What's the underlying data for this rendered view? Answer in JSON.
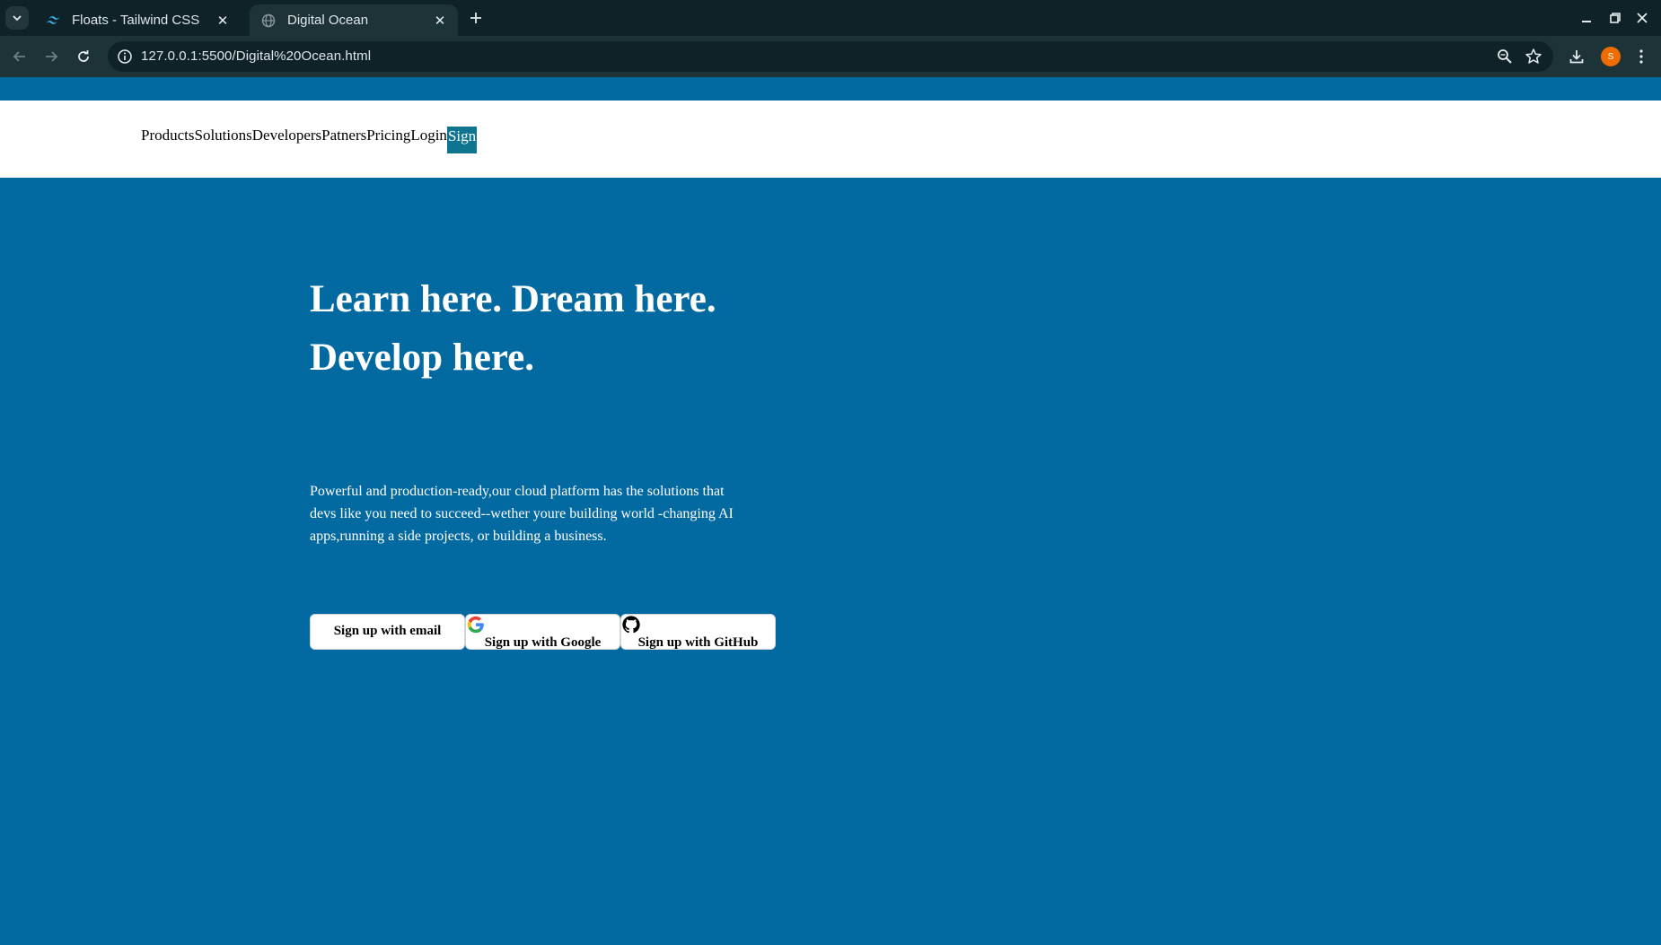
{
  "browser": {
    "tabs": [
      {
        "title": "Floats - Tailwind CSS",
        "favicon": "tailwind-icon"
      },
      {
        "title": "Digital Ocean",
        "favicon": "globe-icon",
        "active": true
      }
    ],
    "url": "127.0.0.1:5500/Digital%20Ocean.html",
    "profile_initial": "S",
    "colors": {
      "chrome_dark": "#0f2228",
      "chrome_mid": "#1e3338",
      "avatar": "#ef6c00"
    }
  },
  "nav": {
    "items": [
      "Products",
      "Solutions",
      "Developers",
      "Patners",
      "Pricing",
      "Login"
    ],
    "sign": "Sign",
    "colors": {
      "sign_bg": "#0e7490"
    }
  },
  "hero": {
    "title_line1": "Learn here. Dream here.",
    "title_line2": "Develop here.",
    "description": "Powerful and production-ready,our cloud platform has the solutions that devs like you need to succeed--wether youre building world -changing AI apps,running a side projects, or building a business.",
    "background": "#0369a1"
  },
  "cta": {
    "email": "Sign up with email",
    "google": "Sign up with Google",
    "github": "Sign up with GitHub"
  }
}
